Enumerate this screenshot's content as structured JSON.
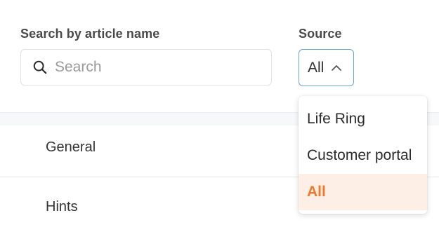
{
  "search": {
    "label": "Search by article name",
    "placeholder": "Search",
    "value": ""
  },
  "source": {
    "label": "Source",
    "selected": "All",
    "options": [
      {
        "label": "Life Ring",
        "selected": false
      },
      {
        "label": "Customer portal",
        "selected": false
      },
      {
        "label": "All",
        "selected": true
      }
    ]
  },
  "list": {
    "rows": [
      {
        "label": "General"
      },
      {
        "label": "Hints"
      }
    ]
  },
  "colors": {
    "accent": "#f07a2c",
    "selected_bg": "#fdeee6",
    "focus_border": "#6aa6c8"
  },
  "icons": {
    "search": "magnifier",
    "chevron": "chevron-up"
  }
}
